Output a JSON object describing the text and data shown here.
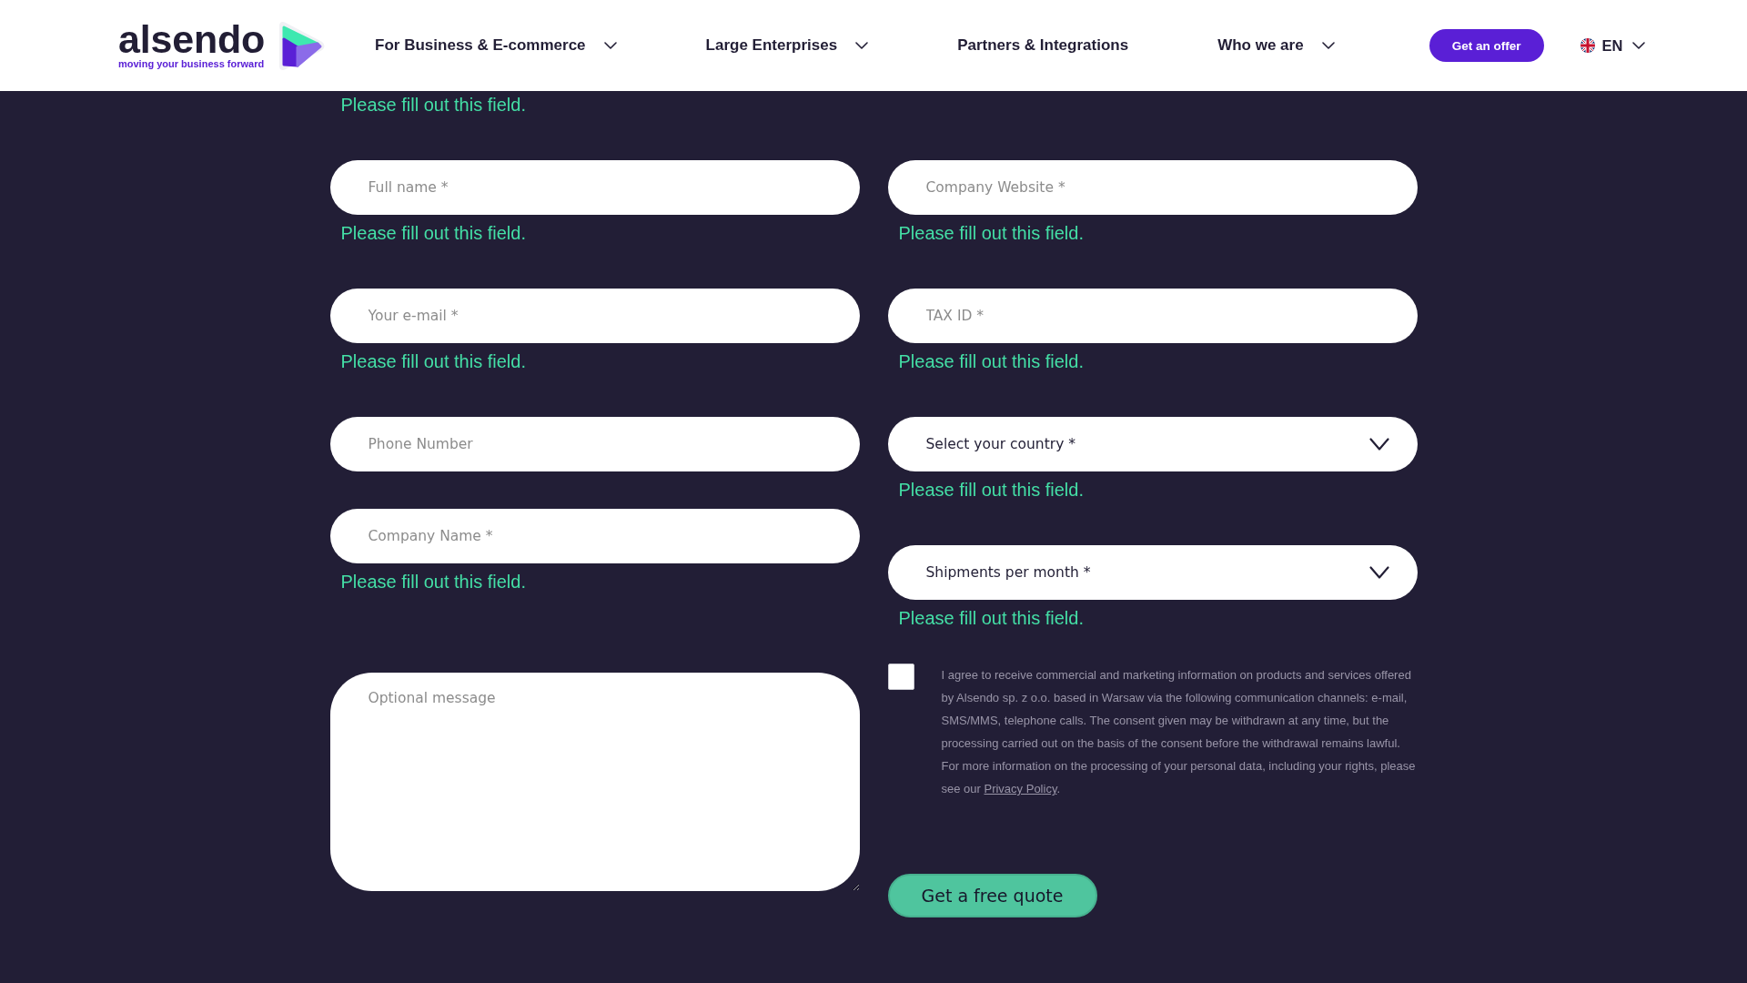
{
  "header": {
    "logo": {
      "wordmark": "alsendo",
      "tagline": "moving your business forward"
    },
    "nav": [
      {
        "label": "For Business & E-commerce",
        "has_menu": true
      },
      {
        "label": "Large Enterprises",
        "has_menu": true
      },
      {
        "label": "Partners & Integrations",
        "has_menu": false
      },
      {
        "label": "Who we are",
        "has_menu": true
      }
    ],
    "cta": "Get an offer",
    "language": {
      "code": "EN"
    }
  },
  "form": {
    "left_column": [
      {
        "kind": "message",
        "error": "Please fill out this field."
      },
      {
        "kind": "input",
        "placeholder": "Full name *",
        "error": "Please fill out this field."
      },
      {
        "kind": "input",
        "placeholder": "Your e-mail *",
        "error": "Please fill out this field."
      },
      {
        "kind": "input",
        "placeholder": "Phone Number"
      },
      {
        "kind": "input",
        "placeholder": "Company Name *",
        "error": "Please fill out this field."
      },
      {
        "kind": "textarea",
        "placeholder": "Optional message"
      }
    ],
    "right_column": [
      {
        "kind": "input",
        "placeholder": "Company Website *",
        "error": "Please fill out this field."
      },
      {
        "kind": "input",
        "placeholder": "TAX ID *",
        "error": "Please fill out this field."
      },
      {
        "kind": "select",
        "prompt": "Select your country *",
        "error": "Please fill out this field."
      },
      {
        "kind": "select",
        "prompt": "Shipments per month *",
        "error": "Please fill out this field."
      }
    ],
    "consent": {
      "checked": false,
      "text": "I agree to receive commercial and marketing information on products and services offered by Alsendo sp. z o.o. based in Warsaw via the following communication channels: e-mail, SMS/MMS, telephone calls. The consent given may be withdrawn at any time, but the processing carried out on the basis of the consent before the withdrawal remains lawful. For more information on the processing of your personal data, including your rights, please see our ",
      "link": "Privacy Policy",
      "after": "."
    },
    "submit": "Get a free quote"
  }
}
